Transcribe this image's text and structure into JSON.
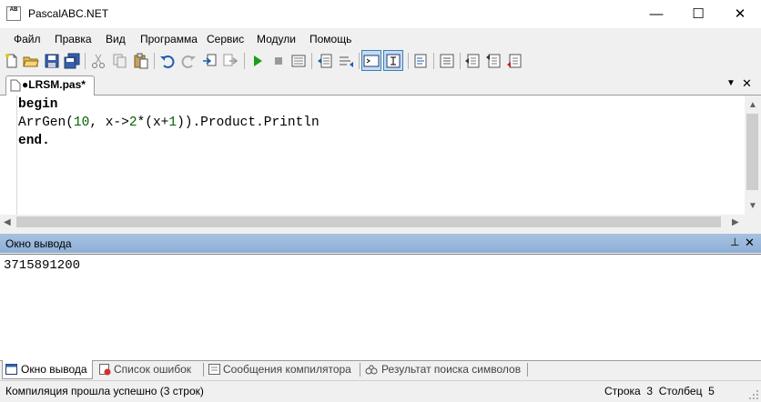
{
  "window": {
    "title": "PascalABC.NET",
    "icon_letters": "AB",
    "minimize": "—",
    "maximize": "☐",
    "close": "✕"
  },
  "menu": [
    "Файл",
    "Правка",
    "Вид",
    "Программа",
    "Сервис",
    "Модули",
    "Помощь"
  ],
  "toolbar": {
    "icons": [
      "new-file-icon",
      "open-folder-icon",
      "save-icon",
      "save-all-icon",
      "cut-icon",
      "copy-icon",
      "paste-icon",
      "undo-icon",
      "redo-icon",
      "find-icon",
      "replace-icon",
      "run-icon",
      "stop-icon",
      "debug-icon",
      "comment-icon",
      "uncomment-icon",
      "output-window-icon",
      "console-icon",
      "format-icon",
      "step-icon",
      "step-into-icon",
      "step-over-icon",
      "step-out-icon"
    ]
  },
  "document_tab": {
    "label": "●LRSM.pas*",
    "dropdown": "▼",
    "close": "✕"
  },
  "editor": {
    "lines": [
      {
        "kw": "begin"
      },
      {
        "code_a": "ArrGen(",
        "num_a": "10",
        "code_b": ", x->",
        "num_b": "2",
        "code_c": "*(x+",
        "num_c": "1",
        "code_d": ")).Product.Println"
      },
      {
        "kw": "end."
      }
    ],
    "scroll_up": "▲",
    "scroll_down": "▼",
    "scroll_left": "◀",
    "scroll_right": "▶"
  },
  "output_panel": {
    "title": "Окно вывода",
    "pin": "⊥",
    "close": "✕",
    "text": "3715891200"
  },
  "bottom_tabs": [
    {
      "label": "Окно вывода"
    },
    {
      "label": "Список ошибок"
    },
    {
      "label": "Сообщения компилятора"
    },
    {
      "label": "Результат поиска символов"
    }
  ],
  "status": {
    "message": "Компиляция прошла успешно (3 строк)",
    "row_label": "Строка",
    "row_value": "3",
    "col_label": "Столбец",
    "col_value": "5"
  },
  "colors": {
    "output_header": "#9db9dc",
    "keyword": "#000000",
    "number": "#006400",
    "pressed_button": "#c4dcf3"
  }
}
